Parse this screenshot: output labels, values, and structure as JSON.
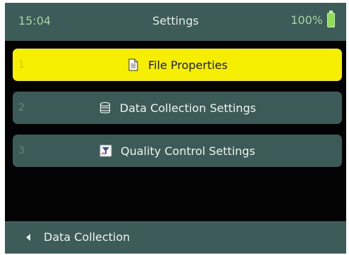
{
  "status_bar": {
    "time": "15:04",
    "title": "Settings",
    "battery": "100%",
    "battery_icon": "battery-full-icon"
  },
  "menu": {
    "items": [
      {
        "number": "1",
        "label": "File Properties",
        "icon": "document-icon",
        "selected": true
      },
      {
        "number": "2",
        "label": "Data Collection Settings",
        "icon": "database-stack-icon",
        "selected": false
      },
      {
        "number": "3",
        "label": "Quality Control Settings",
        "icon": "quality-filter-icon",
        "selected": false
      }
    ]
  },
  "bottom_bar": {
    "back_label": "Data Collection",
    "back_icon": "chevron-left-icon"
  },
  "colors": {
    "bar_bg": "#3d5b58",
    "selected_bg": "#f6ee00",
    "screen_bg": "#030303",
    "battery": "#8fdc57"
  }
}
